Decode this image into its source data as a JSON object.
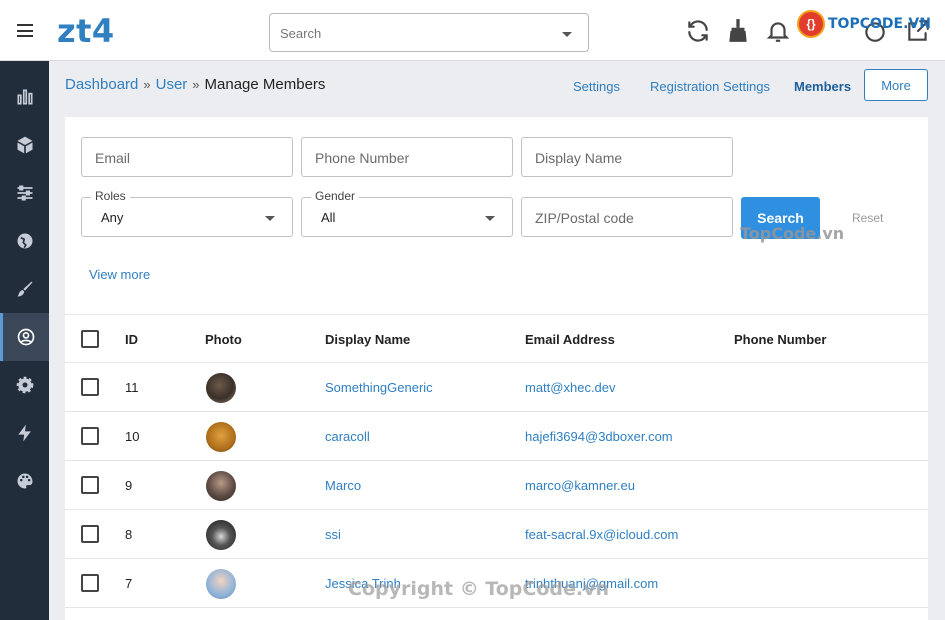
{
  "app": {
    "logo": "zt4"
  },
  "header": {
    "search_placeholder": "Search",
    "icons": [
      "refresh-icon",
      "broom-icon",
      "bell-icon",
      "avatar",
      "power-icon",
      "external-link-icon"
    ]
  },
  "sidebar": {
    "items": [
      {
        "icon": "chart-bar-icon"
      },
      {
        "icon": "cube-icon"
      },
      {
        "icon": "sliders-icon"
      },
      {
        "icon": "globe-icon"
      },
      {
        "icon": "brush-icon"
      },
      {
        "icon": "user-circle-icon",
        "active": true
      },
      {
        "icon": "cog-icon"
      },
      {
        "icon": "bolt-icon"
      },
      {
        "icon": "palette-icon"
      }
    ]
  },
  "breadcrumb": {
    "items": [
      "Dashboard",
      "User"
    ],
    "separator": "»",
    "current": "Manage Members"
  },
  "tabs": {
    "settings": "Settings",
    "registration": "Registration Settings",
    "members": "Members",
    "more": "More"
  },
  "filters": {
    "email_placeholder": "Email",
    "phone_placeholder": "Phone Number",
    "display_name_placeholder": "Display Name",
    "roles_label": "Roles",
    "roles_value": "Any",
    "gender_label": "Gender",
    "gender_value": "All",
    "zip_placeholder": "ZIP/Postal code",
    "search_button": "Search",
    "reset": "Reset",
    "view_more": "View more"
  },
  "table": {
    "columns": [
      "ID",
      "Photo",
      "Display Name",
      "Email Address",
      "Phone Number"
    ],
    "rows": [
      {
        "id": "11",
        "name": "SomethingGeneric",
        "email": "matt@xhec.dev",
        "phone": ""
      },
      {
        "id": "10",
        "name": "caracoll",
        "email": "hajefi3694@3dboxer.com",
        "phone": ""
      },
      {
        "id": "9",
        "name": "Marco",
        "email": "marco@kamner.eu",
        "phone": ""
      },
      {
        "id": "8",
        "name": "ssi",
        "email": "feat-sacral.9x@icloud.com",
        "phone": ""
      },
      {
        "id": "7",
        "name": "Jessica Trinh",
        "email": "trinhthuanj@gmail.com",
        "phone": ""
      }
    ]
  },
  "watermarks": {
    "logo_badge": "{}",
    "logo_text": "TOPCODE.VN",
    "center_text": "TopCode.vn",
    "bottom_text": "Copyright © TopCode.vn"
  },
  "colors": {
    "accent": "#2f7fc1",
    "sidebar_bg": "#222d3c",
    "search_button_bg": "#2f8fe0"
  }
}
